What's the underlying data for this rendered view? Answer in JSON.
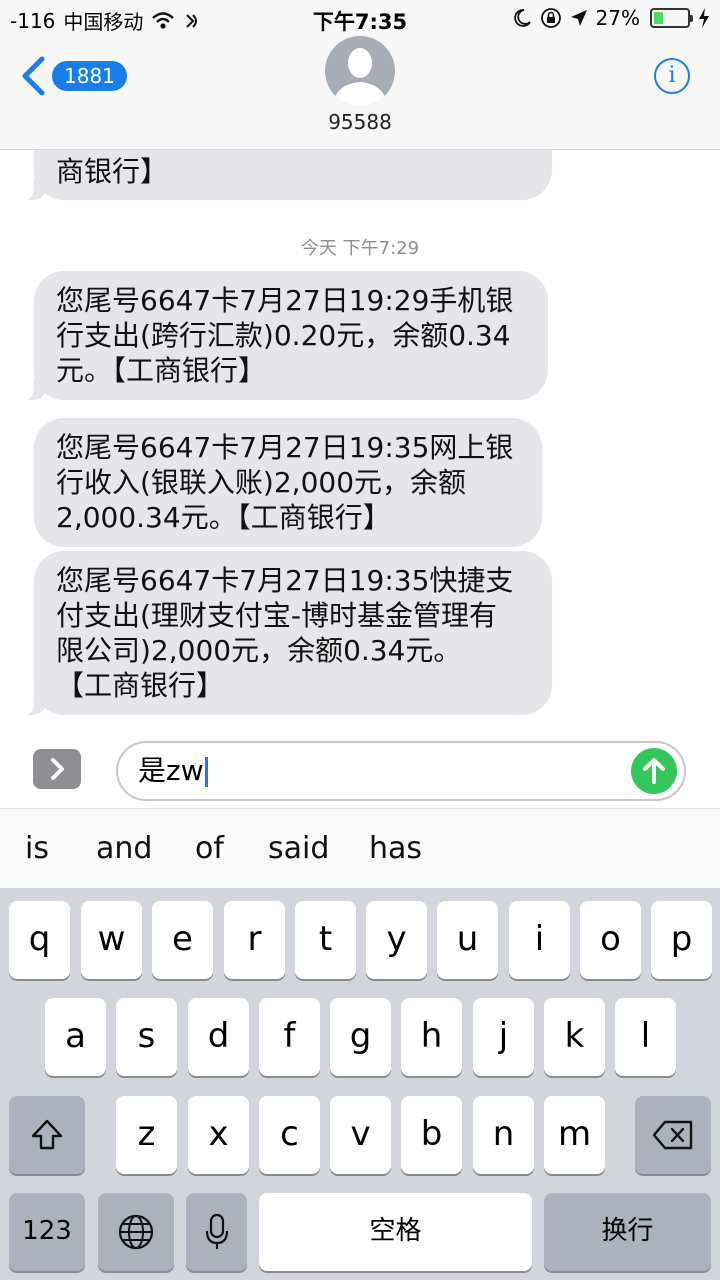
{
  "status_bar": {
    "signal": "-116",
    "carrier": "中国移动",
    "time": "下午7:35",
    "battery_percent": "27%",
    "battery_level": 0.27,
    "icons": [
      "wifi-icon",
      "location-arrow-icon",
      "moon-icon",
      "orientation-lock-icon",
      "charging-bolt-icon"
    ]
  },
  "header": {
    "back_count": "1881",
    "contact": "95588",
    "info_label": "i"
  },
  "messages": {
    "partial_text": "商银行】",
    "timestamp": "今天 下午7:29",
    "items": [
      {
        "line1": "您尾号6647卡7月27日19:29手机银",
        "line2": "行支出(跨行汇款)0.20元，余额0.34",
        "line3": "元。【工商银行】"
      },
      {
        "line1": "您尾号6647卡7月27日19:35网上银",
        "line2": "行收入(银联入账)2,000元，余额",
        "line3": "2,000.34元。【工商银行】"
      },
      {
        "line1": "您尾号6647卡7月27日19:35快捷支",
        "line2": "付支出(理财支付宝-博时基金管理有",
        "line3": "限公司)2,000元，余额0.34元。",
        "line4": "【工商银行】"
      }
    ]
  },
  "composer": {
    "text": "是zw"
  },
  "suggestions": [
    "is",
    "and",
    "of",
    "said",
    "has"
  ],
  "keyboard": {
    "row1": [
      "q",
      "w",
      "e",
      "r",
      "t",
      "y",
      "u",
      "i",
      "o",
      "p"
    ],
    "row2": [
      "a",
      "s",
      "d",
      "f",
      "g",
      "h",
      "j",
      "k",
      "l"
    ],
    "row3": [
      "z",
      "x",
      "c",
      "v",
      "b",
      "n",
      "m"
    ],
    "num_label": "123",
    "space_label": "空格",
    "return_label": "换行"
  },
  "colors": {
    "accent": "#1a7ee8",
    "send": "#34c759",
    "bubble": "#e5e5ea",
    "battery": "#4cd964"
  }
}
